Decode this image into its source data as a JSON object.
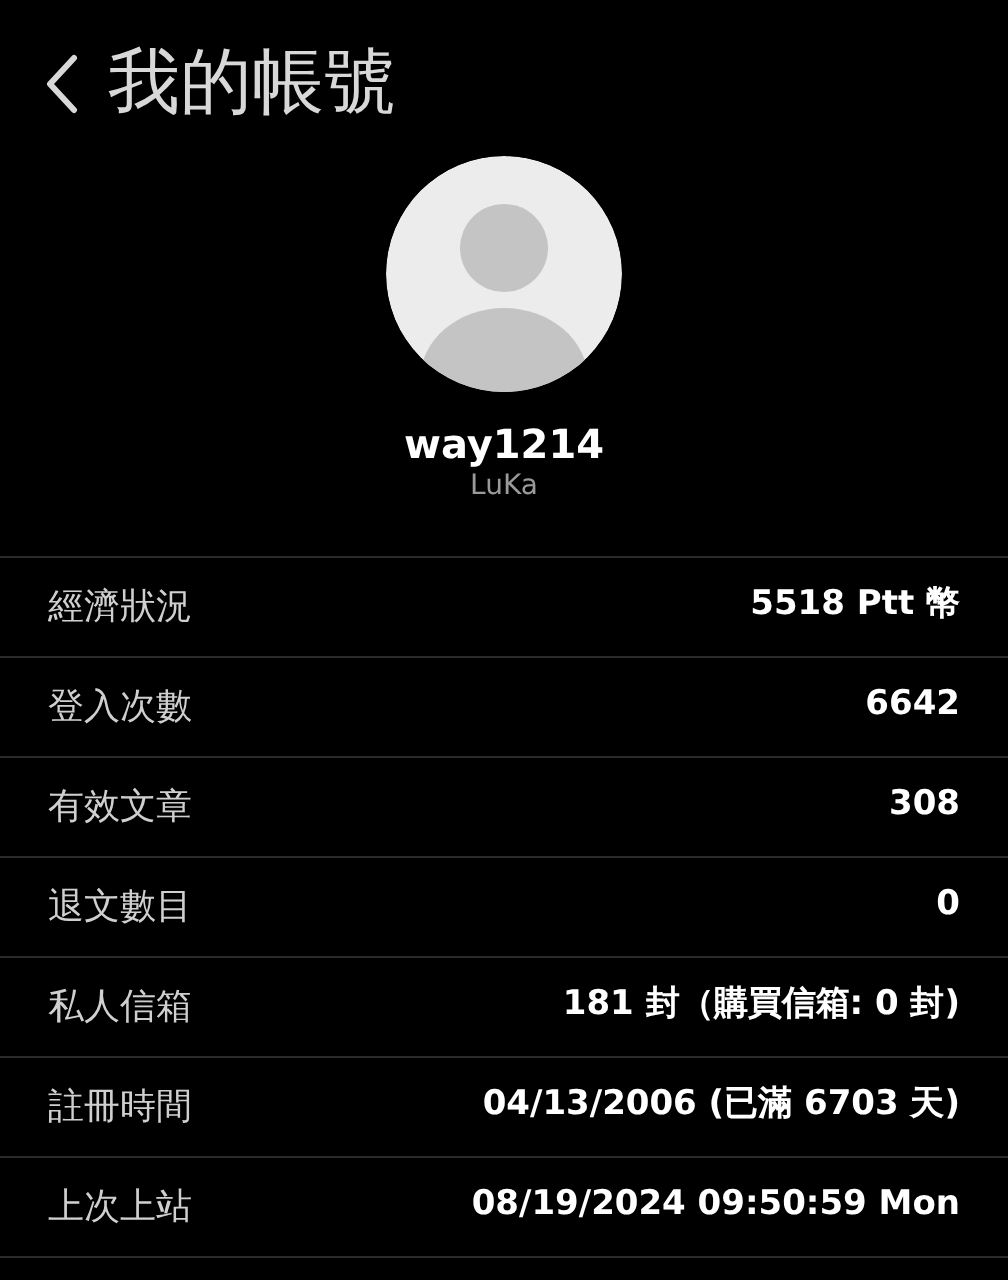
{
  "header": {
    "title": "我的帳號"
  },
  "profile": {
    "username": "way1214",
    "nickname": "LuKa"
  },
  "rows": [
    {
      "label": "經濟狀況",
      "value": "5518 Ptt 幣"
    },
    {
      "label": "登入次數",
      "value": "6642"
    },
    {
      "label": "有效文章",
      "value": "308"
    },
    {
      "label": "退文數目",
      "value": "0"
    },
    {
      "label": "私人信箱",
      "value": "181 封（購買信箱: 0 封)"
    },
    {
      "label": "註冊時間",
      "value": "04/13/2006 (已滿 6703 天)"
    },
    {
      "label": "上次上站",
      "value": "08/19/2024 09:50:59 Mon"
    }
  ]
}
